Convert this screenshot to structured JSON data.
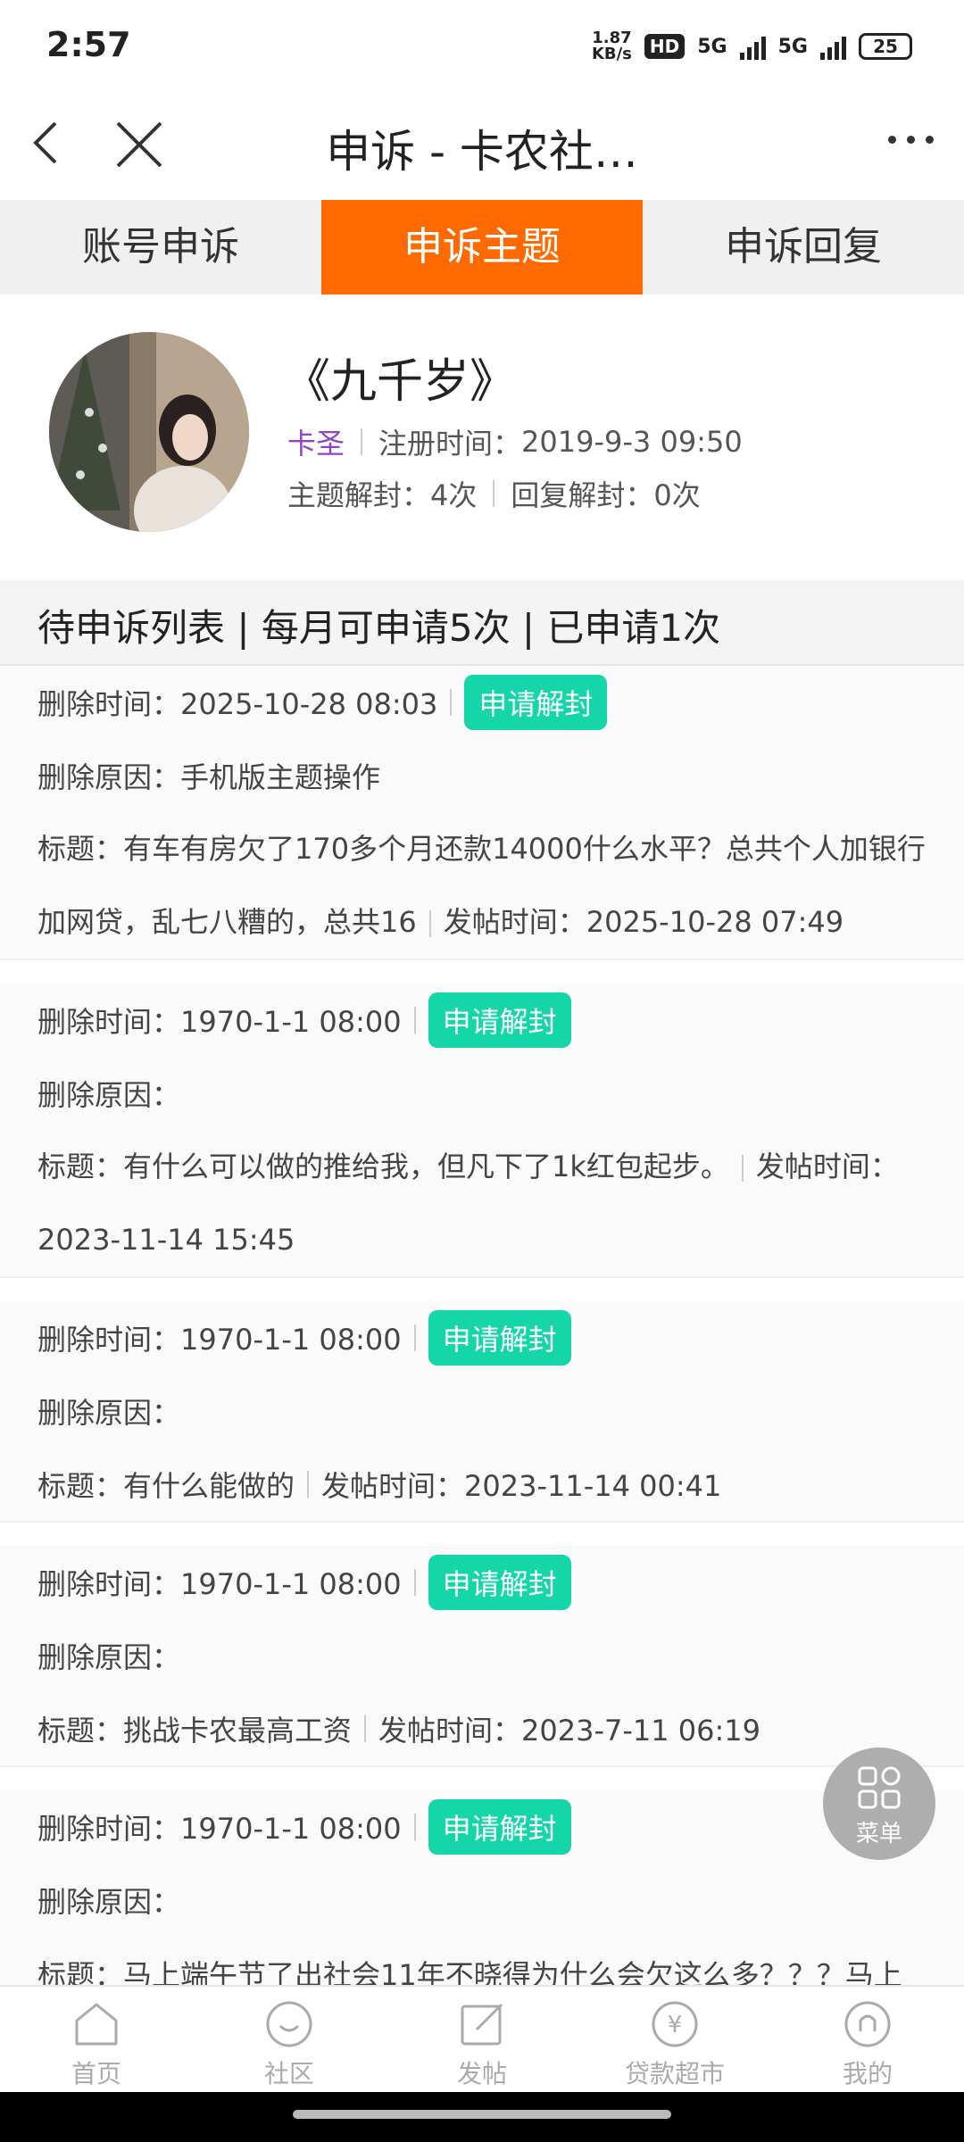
{
  "status": {
    "time": "2:57",
    "speed_top": "1.87",
    "speed_bottom": "KB/s",
    "hd": "HD",
    "net1": "5G",
    "net2": "5G",
    "battery": "25"
  },
  "titlebar": {
    "title": "申诉 - 卡农社…"
  },
  "tabs": [
    {
      "label": "账号申诉",
      "active": false
    },
    {
      "label": "申诉主题",
      "active": true
    },
    {
      "label": "申诉回复",
      "active": false
    }
  ],
  "profile": {
    "name": "《九千岁》",
    "nickname": "卡圣",
    "register_label": "注册时间：",
    "register_time": "2019-9-3 09:50",
    "topic_unblock": "主题解封：4次",
    "reply_unblock": "回复解封：0次"
  },
  "list_header": "待申诉列表 | 每月可申请5次 | 已申请1次",
  "items": [
    {
      "delete_time": "删除时间：2025-10-28 08:03",
      "button": "申请解封",
      "reason": "删除原因：手机版主题操作",
      "title": "标题：有车有房欠了170多个月还款14000什么水平？总共个人加银行加网贷，乱七八糟的，总共16",
      "post_time": "发帖时间：2025-10-28 07:49"
    },
    {
      "delete_time": "删除时间：1970-1-1 08:00",
      "button": "申请解封",
      "reason": "删除原因：",
      "title": "标题：有什么可以做的推给我，但凡下了1k红包起步。",
      "post_time": "发帖时间：2023-11-14 15:45"
    },
    {
      "delete_time": "删除时间：1970-1-1 08:00",
      "button": "申请解封",
      "reason": "删除原因：",
      "title": "标题：有什么能做的",
      "post_time": "发帖时间：2023-11-14 00:41"
    },
    {
      "delete_time": "删除时间：1970-1-1 08:00",
      "button": "申请解封",
      "reason": "删除原因：",
      "title": "标题：挑战卡农最高工资",
      "post_time": "发帖时间：2023-7-11 06:19"
    },
    {
      "delete_time": "删除时间：1970-1-1 08:00",
      "button": "申请解封",
      "reason": "删除原因：",
      "title": "标题：马上端午节了出社会11年不晓得为什么会欠这么多？？？马上"
    }
  ],
  "fab": {
    "label": "菜单"
  },
  "bottom_nav": [
    {
      "label": "首页",
      "icon": "home-icon"
    },
    {
      "label": "社区",
      "icon": "community-icon"
    },
    {
      "label": "发帖",
      "icon": "post-icon"
    },
    {
      "label": "贷款超市",
      "icon": "loan-market-icon"
    },
    {
      "label": "我的",
      "icon": "profile-icon"
    }
  ],
  "colors": {
    "accent": "#ff6a00",
    "unblock_button": "#15d6a8",
    "nickname": "#8e44c6"
  }
}
